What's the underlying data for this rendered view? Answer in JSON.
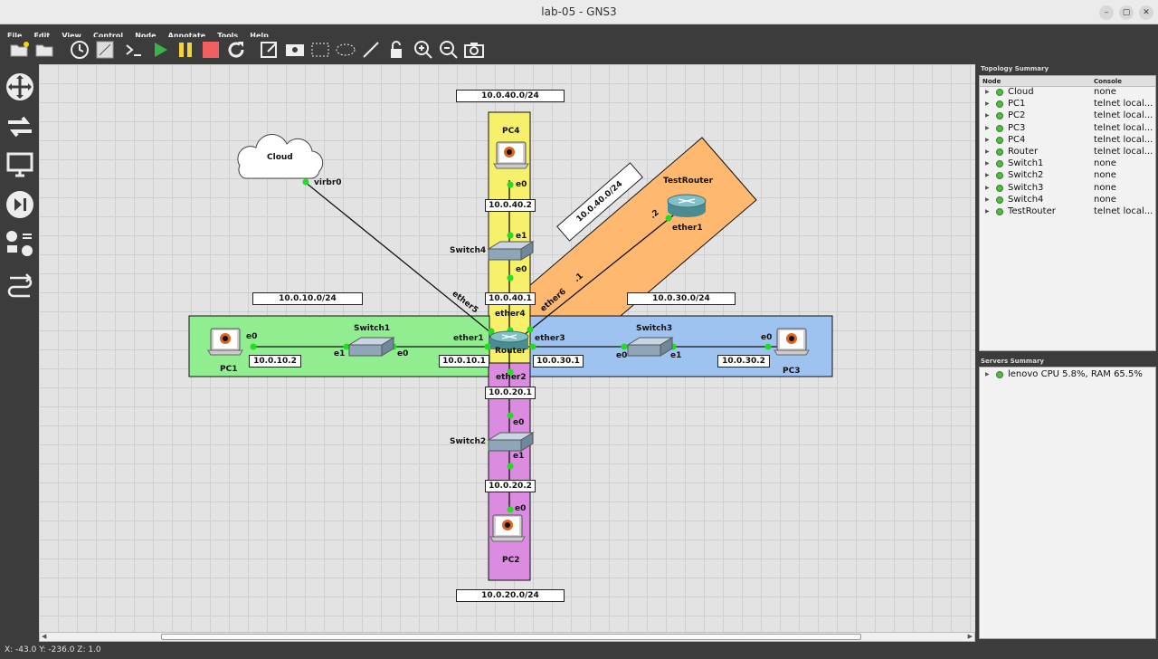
{
  "window": {
    "title": "lab-05 - GNS3"
  },
  "menu": [
    {
      "label": "File"
    },
    {
      "label": "Edit"
    },
    {
      "label": "View"
    },
    {
      "label": "Control"
    },
    {
      "label": "Node"
    },
    {
      "label": "Annotate"
    },
    {
      "label": "Tools"
    },
    {
      "label": "Help"
    }
  ],
  "toolbar_icons": [
    "open-folder-icon",
    "folder-icon",
    "clock-icon",
    "snapshot-icon",
    "terminal-icon",
    "play-icon",
    "pause-icon",
    "stop-icon",
    "reload-icon",
    "edit-note-icon",
    "image-icon",
    "rectangle-icon",
    "ellipse-icon",
    "line-icon",
    "lock-icon",
    "zoom-in-icon",
    "zoom-out-icon",
    "camera-icon"
  ],
  "dock_icons": [
    "router-icon",
    "switch-icon",
    "pc-icon",
    "security-icon",
    "all-devices-icon",
    "link-icon"
  ],
  "canvas": {
    "nodes": {
      "cloud": "Cloud",
      "pc1": "PC1",
      "pc2": "PC2",
      "pc3": "PC3",
      "pc4": "PC4",
      "router": "Router",
      "testrouter": "TestRouter",
      "switch1": "Switch1",
      "switch2": "Switch2",
      "switch3": "Switch3",
      "switch4": "Switch4"
    },
    "ports": {
      "virbr0": "virbr0",
      "ether5": "ether5",
      "ether6": "ether6",
      "ether4": "ether4",
      "ether1": "ether1",
      "ether3": "ether3",
      "ether2": "ether2",
      "tr_ether1": "ether1",
      "pc1_e0": "e0",
      "sw1_e1": "e1",
      "sw1_e0": "e0",
      "sw3_e0": "e0",
      "sw3_e1": "e1",
      "pc3_e0": "e0",
      "pc4_e0": "e0",
      "sw4_e1": "e1",
      "sw4_e0": "e0",
      "sw2_e0": "e0",
      "sw2_e1": "e1",
      "pc2_e0": "e0",
      "dot2": ".2",
      "dot1": ".1"
    },
    "notes": {
      "net40_top": "10.0.40.0/24",
      "net40_diag": "10.0.40.0/24",
      "net10": "10.0.10.0/24",
      "net30": "10.0.30.0/24",
      "net20_bottom": "10.0.20.0/24",
      "ip_pc4": "10.0.40.2",
      "ip_r40": "10.0.40.1",
      "ip_pc1": "10.0.10.2",
      "ip_r10": "10.0.10.1",
      "ip_r30": "10.0.30.1",
      "ip_pc3": "10.0.30.2",
      "ip_r20": "10.0.20.1",
      "ip_pc2": "10.0.20.2"
    },
    "colors": {
      "yellow": "#f7f06a",
      "green": "#90ee90",
      "blue": "#9ec3f0",
      "magenta": "#dc8ce0",
      "orange": "#ffb870",
      "link_dot": "#22dd22"
    }
  },
  "topology_summary": {
    "title": "Topology Summary",
    "headers": {
      "node": "Node",
      "console": "Console"
    },
    "rows": [
      {
        "node": "Cloud",
        "console": "none"
      },
      {
        "node": "PC1",
        "console": "telnet local..."
      },
      {
        "node": "PC2",
        "console": "telnet local..."
      },
      {
        "node": "PC3",
        "console": "telnet local..."
      },
      {
        "node": "PC4",
        "console": "telnet local..."
      },
      {
        "node": "Router",
        "console": "telnet local..."
      },
      {
        "node": "Switch1",
        "console": "none"
      },
      {
        "node": "Switch2",
        "console": "none"
      },
      {
        "node": "Switch3",
        "console": "none"
      },
      {
        "node": "Switch4",
        "console": "none"
      },
      {
        "node": "TestRouter",
        "console": "telnet local..."
      }
    ]
  },
  "servers_summary": {
    "title": "Servers Summary",
    "server": "lenovo CPU 5.8%, RAM 65.5%"
  },
  "status": {
    "coords": "X: -43.0 Y: -236.0 Z: 1.0"
  }
}
